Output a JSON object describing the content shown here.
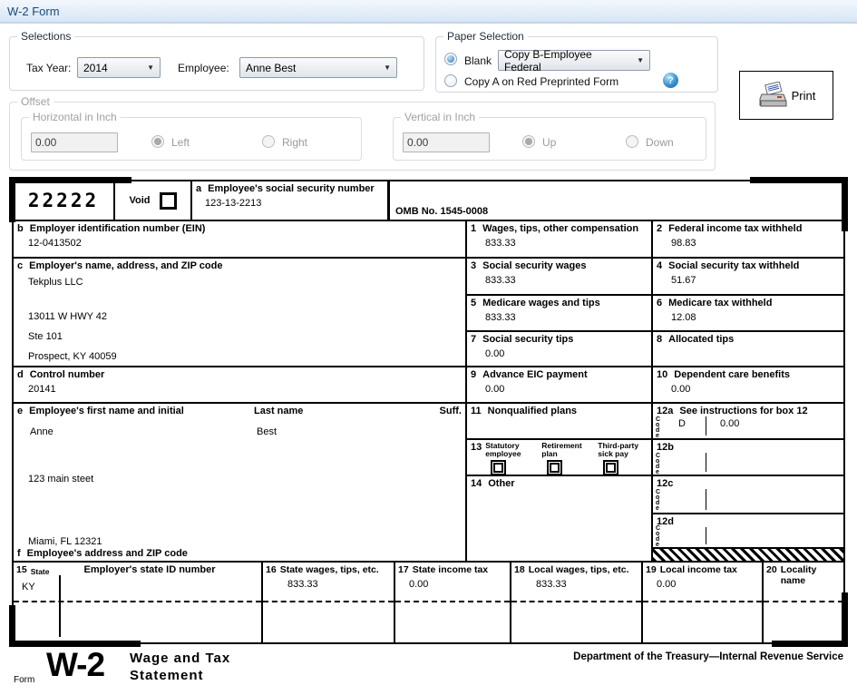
{
  "window": {
    "title": "W-2 Form"
  },
  "selections": {
    "label": "Selections",
    "tax_year_label": "Tax Year:",
    "tax_year_value": "2014",
    "employee_label": "Employee:",
    "employee_value": "Anne Best"
  },
  "paper_selection": {
    "label": "Paper Selection",
    "blank_label": "Blank",
    "copy_type_value": "Copy B-Employee Federal",
    "copy_a_label": "Copy A on Red Preprinted Form",
    "help_glyph": "?"
  },
  "print": {
    "label": "Print"
  },
  "offset": {
    "label": "Offset",
    "horizontal_label": "Horizontal in Inch",
    "horizontal_value": "0.00",
    "left_label": "Left",
    "right_label": "Right",
    "vertical_label": "Vertical in Inch",
    "vertical_value": "0.00",
    "up_label": "Up",
    "down_label": "Down"
  },
  "form": {
    "code22222": "22222",
    "void_label": "Void",
    "omb": "OMB No. 1545-0008",
    "code_vertical": "Code",
    "a": {
      "num": "a",
      "label": "Employee's social security number",
      "value": "123-13-2213"
    },
    "b": {
      "num": "b",
      "label": "Employer identification number (EIN)",
      "value": "12-0413502"
    },
    "c": {
      "num": "c",
      "label": "Employer's name, address, and ZIP code",
      "line1": "Tekplus LLC",
      "line2": "13011 W HWY 42",
      "line3": "Ste 101",
      "line4": "Prospect, KY 40059"
    },
    "d": {
      "num": "d",
      "label": "Control number",
      "value": "20141"
    },
    "e": {
      "num": "e",
      "label": "Employee's first name and initial",
      "last_label": "Last name",
      "suff_label": "Suff.",
      "first_value": "Anne",
      "last_value": "Best",
      "addr1": "123 main steet",
      "addr2": "Miami, FL 12321"
    },
    "f": {
      "num": "f",
      "label": "Employee's address and ZIP code"
    },
    "b1": {
      "num": "1",
      "label": "Wages, tips, other compensation",
      "value": "833.33"
    },
    "b2": {
      "num": "2",
      "label": "Federal income tax withheld",
      "value": "98.83"
    },
    "b3": {
      "num": "3",
      "label": "Social security wages",
      "value": "833.33"
    },
    "b4": {
      "num": "4",
      "label": "Social security tax withheld",
      "value": "51.67"
    },
    "b5": {
      "num": "5",
      "label": "Medicare wages and tips",
      "value": "833.33"
    },
    "b6": {
      "num": "6",
      "label": "Medicare tax withheld",
      "value": "12.08"
    },
    "b7": {
      "num": "7",
      "label": "Social security tips",
      "value": "0.00"
    },
    "b8": {
      "num": "8",
      "label": "Allocated tips",
      "value": ""
    },
    "b9": {
      "num": "9",
      "label": "Advance EIC payment",
      "value": "0.00"
    },
    "b10": {
      "num": "10",
      "label": "Dependent care benefits",
      "value": "0.00"
    },
    "b11": {
      "num": "11",
      "label": "Nonqualified plans",
      "value": ""
    },
    "b12a": {
      "num": "12a",
      "label": "See instructions for box 12",
      "code": "D",
      "value": "0.00"
    },
    "b12b": {
      "num": "12b"
    },
    "b12c": {
      "num": "12c"
    },
    "b12d": {
      "num": "12d"
    },
    "b13": {
      "num": "13",
      "item1": "Statutory employee",
      "item2": "Retirement plan",
      "item3": "Third-party sick pay"
    },
    "b14": {
      "num": "14",
      "label": "Other"
    },
    "b15": {
      "num": "15",
      "state_label": "State",
      "state_value": "KY",
      "id_label": "Employer's state ID number"
    },
    "b16": {
      "num": "16",
      "label": "State wages, tips, etc.",
      "value": "833.33"
    },
    "b17": {
      "num": "17",
      "label": "State income tax",
      "value": "0.00"
    },
    "b18": {
      "num": "18",
      "label": "Local wages, tips, etc.",
      "value": "833.33"
    },
    "b19": {
      "num": "19",
      "label": "Local income tax",
      "value": "0.00"
    },
    "b20": {
      "num": "20",
      "label": "Locality name",
      "value": ""
    }
  },
  "footer": {
    "form_word": "Form",
    "form_number": "W-2",
    "title1": "Wage and Tax",
    "title2": "Statement",
    "agency": "Department of the Treasury—Internal Revenue Service"
  }
}
